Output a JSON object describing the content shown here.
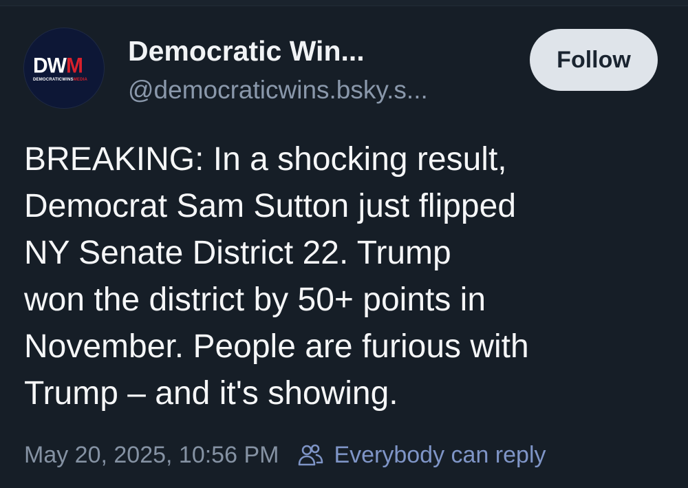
{
  "author": {
    "display_name": "Democratic Win...",
    "handle": "@democraticwins.bsky.s...",
    "avatar": {
      "logo_text_main": "DW",
      "logo_text_accent": "M",
      "logo_subtext_main": "DEMOCRATICWINS",
      "logo_subtext_accent": "MEDIA",
      "accent_color": "#d8202c",
      "background_color": "#0d1736"
    }
  },
  "actions": {
    "follow_label": "Follow"
  },
  "post": {
    "lines": [
      "BREAKING: In a shocking result,",
      "Democrat Sam Sutton just flipped",
      "NY Senate District 22. Trump",
      "won the district by 50+ points in",
      "November. People are furious with",
      "Trump – and it's showing."
    ]
  },
  "meta": {
    "timestamp": "May 20, 2025, 10:56 PM",
    "reply_setting": "Everybody can reply",
    "reply_icon": "people-icon"
  },
  "colors": {
    "background": "#161e27",
    "text_primary": "#f5f6f7",
    "text_secondary": "#8a98ab",
    "link_accent": "#7f95c7",
    "follow_button_bg": "#dfe4ea"
  }
}
